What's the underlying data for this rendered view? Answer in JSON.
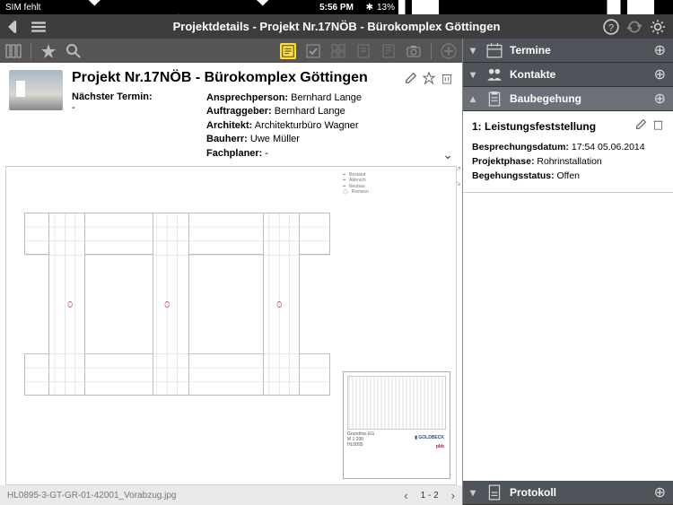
{
  "status": {
    "carrier": "SIM fehlt",
    "time": "5:56 PM",
    "battery": "13%"
  },
  "header": {
    "title": "Projektdetails - Projekt Nr.17NÖB - Bürokomplex Göttingen"
  },
  "project": {
    "title": "Projekt Nr.17NÖB - Bürokomplex Göttingen",
    "next_date_label": "Nächster Termin:",
    "next_date_value": "-",
    "fields": {
      "ansprechperson_label": "Ansprechperson:",
      "ansprechperson": "Bernhard Lange",
      "auftraggeber_label": "Auftraggeber:",
      "auftraggeber": "Bernhard Lange",
      "architekt_label": "Architekt:",
      "architekt": "Architekturbüro Wagner",
      "bauherr_label": "Bauherr:",
      "bauherr": "Uwe Müller",
      "fachplaner_label": "Fachplaner:",
      "fachplaner": "-"
    }
  },
  "pager": {
    "filename": "HL0895-3-GT-GR-01-42001_Vorabzug.jpg",
    "page": "1 - 2"
  },
  "sections": {
    "termine": "Termine",
    "kontakte": "Kontakte",
    "baubegehung": "Baubegehung",
    "protokoll": "Protokoll"
  },
  "begehung": {
    "title": "1: Leistungsfeststellung",
    "datum_label": "Besprechungsdatum:",
    "datum": "17:54 05.06.2014",
    "phase_label": "Projektphase:",
    "phase": "Rohrinstallation",
    "status_label": "Begehungsstatus:",
    "status": "Offen"
  }
}
